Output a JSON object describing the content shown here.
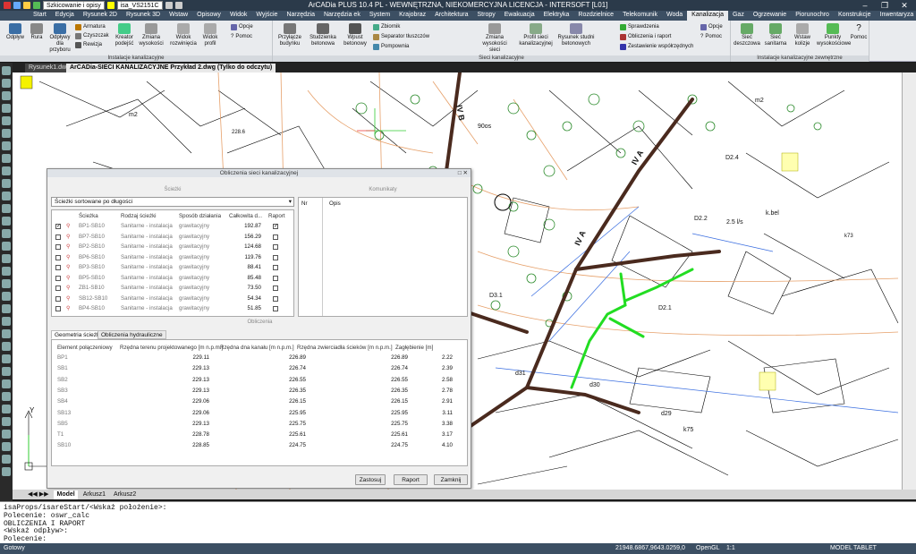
{
  "app": {
    "title": "ArCADia PLUS 10.4 PL - WEWNĘTRZNA, NIEKOMERCYJNA LICENCJA - INTERSOFT [L01]",
    "workspace": "Szkicowanie i opisy",
    "layer": "isa_VS2151C"
  },
  "tabs": [
    "Start",
    "Edycja",
    "Rysunek 2D",
    "Rysunek 3D",
    "Wstaw",
    "Opisowy",
    "Widok",
    "Wyjście",
    "Narzędzia",
    "Narzędzia ek",
    "System",
    "Krajobraz",
    "Architektura",
    "Stropy",
    "Ewakuacja",
    "Elektryka",
    "Rozdzielnice",
    "Telekomunik",
    "Woda",
    "Kanalizacja",
    "Gaz",
    "Ogrzewanie",
    "Piorunochro",
    "Konstrukcje",
    "Inwentaryza",
    "Pomoc"
  ],
  "active_tab": "Kanalizacja",
  "ribbon": {
    "g1": {
      "caption": "Instalacje kanalizacyjne",
      "odplyw": "Odpływ",
      "rura": "Rura",
      "odplywy_dla_przyboru": "Odpływy dla przyboru",
      "armatura": "Armatura",
      "czyszczak": "Czyszczak",
      "rewizja": "Rewizja",
      "kreator_podejsc": "Kreator podejść",
      "zmiana_wysokosci": "Zmiana wysokości",
      "widok_rozwinietego": "Widok rozwinięcia",
      "widok_profil": "Widok profil",
      "opcje": "Opcje",
      "pomoc": "Pomoc"
    },
    "g2": {
      "caption": "Sieci kanalizacyjne",
      "przylacze": "Przyłącze budynku",
      "studzienka": "Studzienka betonowa",
      "wpust": "Wpust betonowy",
      "zbiornik": "Zbiornik",
      "separator": "Separator tłuszczów",
      "pompownia": "Pompownia",
      "zmiana_wysokosci": "Zmiana wysokości sieci",
      "profil": "Profil sieci kanalizacyjnej",
      "rysunek_studni": "Rysunek studni betonowych",
      "sprawdzenia": "Sprawdzenia",
      "obliczenia": "Obliczenia i raport",
      "zestawienie": "Zestawienie współrzędnych",
      "opcje": "Opcje",
      "pomoc": "Pomoc"
    },
    "g3": {
      "caption": "Instalacje kanalizacyjne zewnętrzne",
      "siec_deszczowa": "Sieć deszczowa",
      "siec_sanitarna": "Sieć sanitarna",
      "wstaw_kolizje": "Wstaw kolizje",
      "punkty": "Punkty wysokościowe",
      "pomoc": "Pomoc"
    }
  },
  "doc_tabs": [
    "Rysunek1.dwg",
    "ArCADia-SIECI KANALIZACYJNE Przykład 2.dwg (Tylko do odczytu)"
  ],
  "dialog": {
    "title": "Obliczenia sieci kanalizacyjnej",
    "sciezki_label": "Ścieżki",
    "komunikaty_label": "Komunikaty",
    "obliczenia_label": "Obliczenia",
    "sort_combo": "Ścieżki sortowane po długości",
    "cols": [
      "Ścieżka",
      "Rodzaj ścieżki",
      "Sposób działania",
      "Całkowita d...",
      "Raport"
    ],
    "rows": [
      {
        "name": "BP1-SB10",
        "type": "Sanitarne - instalacja",
        "mode": "grawitacyjny",
        "len": "192.87",
        "checked": true,
        "report": true
      },
      {
        "name": "BP7-SB10",
        "type": "Sanitarne - instalacja",
        "mode": "grawitacyjny",
        "len": "156.29",
        "checked": false,
        "report": false
      },
      {
        "name": "BP2-SB10",
        "type": "Sanitarne - instalacja",
        "mode": "grawitacyjny",
        "len": "124.68",
        "checked": false,
        "report": false
      },
      {
        "name": "BP6-SB10",
        "type": "Sanitarne - instalacja",
        "mode": "grawitacyjny",
        "len": "119.76",
        "checked": false,
        "report": false
      },
      {
        "name": "BP3-SB10",
        "type": "Sanitarne - instalacja",
        "mode": "grawitacyjny",
        "len": "88.41",
        "checked": false,
        "report": false
      },
      {
        "name": "BP5-SB10",
        "type": "Sanitarne - instalacja",
        "mode": "grawitacyjny",
        "len": "85.48",
        "checked": false,
        "report": false
      },
      {
        "name": "ZB1-SB10",
        "type": "Sanitarne - instalacja",
        "mode": "grawitacyjny",
        "len": "73.50",
        "checked": false,
        "report": false
      },
      {
        "name": "SB12-SB10",
        "type": "Sanitarne - instalacja",
        "mode": "grawitacyjny",
        "len": "54.34",
        "checked": false,
        "report": false
      },
      {
        "name": "BP4-SB10",
        "type": "Sanitarne - instalacja",
        "mode": "grawitacyjny",
        "len": "51.85",
        "checked": false,
        "report": false
      }
    ],
    "msg_cols": [
      "Nr",
      "Opis"
    ],
    "subtabs": [
      "Geometria ścieżki",
      "Obliczenia hydrauliczne"
    ],
    "geo_cols": [
      "Element połączeniowy",
      "Rzędna terenu projektowanego [m n.p.m.]",
      "Rzędna dna kanału [m n.p.m.]",
      "Rzędna zwierciadła ścieków [m n.p.m.]",
      "Zagłębienie [m]"
    ],
    "geo_rows": [
      [
        "BP1",
        "229.11",
        "226.89",
        "226.89",
        "2.22"
      ],
      [
        "SB1",
        "229.13",
        "226.74",
        "226.74",
        "2.39"
      ],
      [
        "SB2",
        "229.13",
        "226.55",
        "226.55",
        "2.58"
      ],
      [
        "SB3",
        "229.13",
        "226.35",
        "226.35",
        "2.78"
      ],
      [
        "SB4",
        "229.06",
        "226.15",
        "226.15",
        "2.91"
      ],
      [
        "SB13",
        "229.06",
        "225.95",
        "225.95",
        "3.11"
      ],
      [
        "SB5",
        "229.13",
        "225.75",
        "225.75",
        "3.38"
      ],
      [
        "T1",
        "228.78",
        "225.61",
        "225.61",
        "3.17"
      ],
      [
        "SB10",
        "228.85",
        "224.75",
        "224.75",
        "4.10"
      ]
    ],
    "buttons": {
      "apply": "Zastosuj",
      "report": "Raport",
      "close": "Zamknij"
    }
  },
  "sheet_tabs": [
    "Model",
    "Arkusz1",
    "Arkusz2"
  ],
  "command_lines": [
    "isaProps/isareStart/<Wskaż położenie>:",
    "Polecenie: oswr_calc",
    "OBLICZENIA I RAPORT",
    "<Wskaż odpływ>:",
    "Polecenie:"
  ],
  "status": {
    "left": "Gotowy",
    "coords": "21948.6867,9643.0259,0",
    "renderer": "OpenGL",
    "scale": "1:1",
    "model": "MODEL",
    "tablet": "TABLET"
  },
  "colors": {
    "ribbon_bg": "#e9ebee",
    "title_bg": "#2b3a4a",
    "pipe_brown": "#4a2a1e",
    "pipe_green": "#22dd22"
  },
  "map_labels": [
    "IV B",
    "IV A",
    "IV A",
    "D3.1",
    "d30",
    "d29",
    "d31",
    "k75",
    "2.5 l/s",
    "D2.2",
    "D2.1",
    "D2.4",
    "k.bel",
    "m2",
    "90os",
    "m2",
    "228.6",
    "k73"
  ]
}
